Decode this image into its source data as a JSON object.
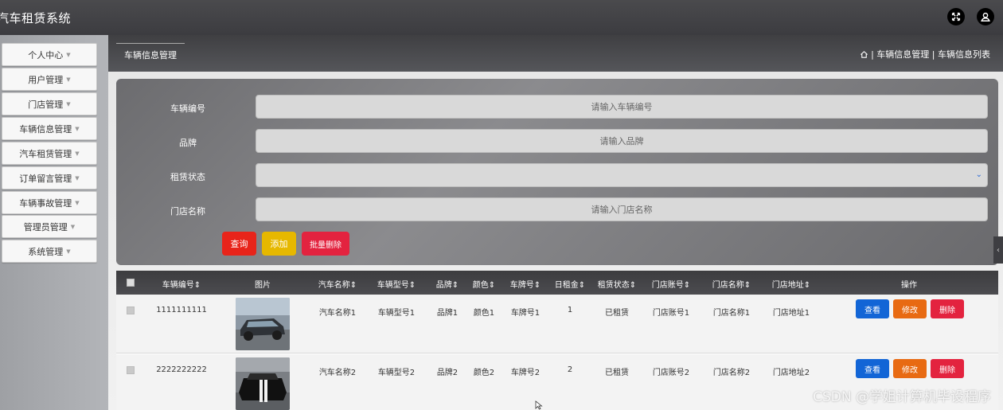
{
  "app": {
    "title": "汽车租赁系统"
  },
  "header_icons": [
    "fullscreen-icon",
    "user-icon"
  ],
  "sidebar": {
    "items": [
      {
        "label": "个人中心"
      },
      {
        "label": "用户管理"
      },
      {
        "label": "门店管理"
      },
      {
        "label": "车辆信息管理"
      },
      {
        "label": "汽车租赁管理"
      },
      {
        "label": "订单留言管理"
      },
      {
        "label": "车辆事故管理"
      },
      {
        "label": "管理员管理"
      },
      {
        "label": "系统管理"
      }
    ]
  },
  "page": {
    "tab": "车辆信息管理",
    "breadcrumb": "| 车辆信息管理 | 车辆信息列表"
  },
  "search": {
    "fields": [
      {
        "label": "车辆编号",
        "placeholder": "请输入车辆编号"
      },
      {
        "label": "品牌",
        "placeholder": "请输入品牌"
      },
      {
        "label": "租赁状态",
        "placeholder": ""
      },
      {
        "label": "门店名称",
        "placeholder": "请输入门店名称"
      }
    ],
    "buttons": {
      "query": "查询",
      "add": "添加",
      "batch_delete": "批量删除"
    }
  },
  "table": {
    "columns": [
      "车辆编号",
      "图片",
      "汽车名称",
      "车辆型号",
      "品牌",
      "颜色",
      "车牌号",
      "日租金",
      "租赁状态",
      "门店账号",
      "门店名称",
      "门店地址",
      "操作"
    ],
    "sortable": [
      true,
      false,
      true,
      true,
      true,
      true,
      true,
      true,
      true,
      true,
      true,
      true,
      false
    ],
    "rows": [
      {
        "id": "1111111111",
        "name": "汽车名称1",
        "model": "车辆型号1",
        "brand": "品牌1",
        "color": "颜色1",
        "plate": "车牌号1",
        "rent": "1",
        "status": "已租赁",
        "store_account": "门店账号1",
        "store_name": "门店名称1",
        "store_addr": "门店地址1"
      },
      {
        "id": "2222222222",
        "name": "汽车名称2",
        "model": "车辆型号2",
        "brand": "品牌2",
        "color": "颜色2",
        "plate": "车牌号2",
        "rent": "2",
        "status": "已租赁",
        "store_account": "门店账号2",
        "store_name": "门店名称2",
        "store_addr": "门店地址2"
      }
    ],
    "actions": {
      "view": "查看",
      "edit": "修改",
      "delete": "删除"
    }
  },
  "colors": {
    "query": "#e8241a",
    "add": "#e6b800",
    "batch_delete": "#e3233f",
    "view": "#1265d6",
    "edit": "#e86a12",
    "delete": "#e3233f"
  },
  "watermark": "CSDN @学姐计算机毕设程序"
}
